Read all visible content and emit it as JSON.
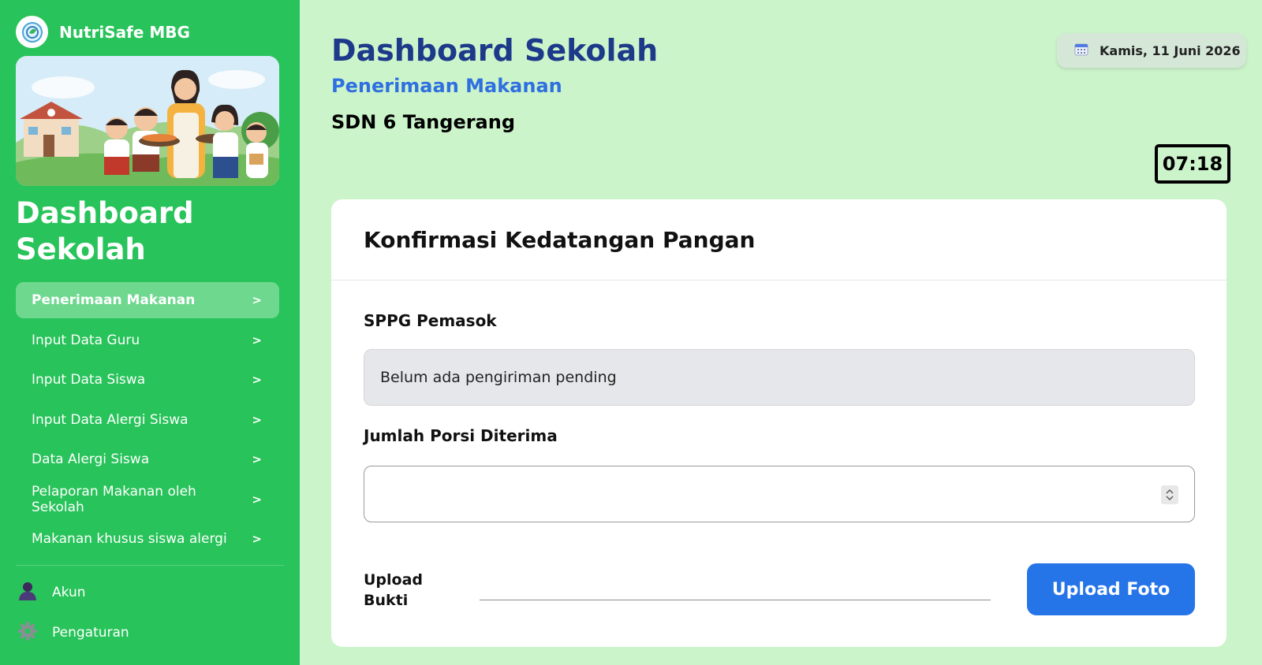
{
  "brand": {
    "name": "NutriSafe MBG",
    "logo_icon": "shield-leaf-icon"
  },
  "sidebar": {
    "title_line1": "Dashboard",
    "title_line2": "Sekolah",
    "items": [
      {
        "label": "Penerimaan Makanan",
        "arrow": ">",
        "active": true
      },
      {
        "label": "Input Data Guru",
        "arrow": ">"
      },
      {
        "label": "Input Data Siswa",
        "arrow": ">"
      },
      {
        "label": "Input Data Alergi Siswa",
        "arrow": ">"
      },
      {
        "label": "Data Alergi Siswa",
        "arrow": ">"
      },
      {
        "label": "Pelaporan Makanan oleh Sekolah",
        "arrow": ">"
      },
      {
        "label": "Makanan khusus siswa alergi",
        "arrow": ">"
      }
    ],
    "footer": [
      {
        "label": "Akun",
        "icon": "user-icon"
      },
      {
        "label": "Pengaturan",
        "icon": "gear-icon"
      }
    ]
  },
  "header": {
    "title": "Dashboard Sekolah",
    "subtitle": "Penerimaan Makanan",
    "school": "SDN 6 Tangerang",
    "date": "Kamis, 11 Juni 2026",
    "date_icon": "calendar-icon",
    "clock": "07:18"
  },
  "card": {
    "title": "Konfirmasi Kedatangan Pangan",
    "supplier_label": "SPPG Pemasok",
    "supplier_value": "Belum ada pengiriman pending",
    "portion_label": "Jumlah Porsi Diterima",
    "portion_value": "",
    "upload_label": "Upload Bukti",
    "upload_button": "Upload Foto"
  },
  "colors": {
    "sidebar": "#28c35a",
    "page_bg": "#ccf4cb",
    "title_blue": "#1d3a8a",
    "subtitle_blue": "#2f6fe0",
    "button_blue": "#2575e8"
  }
}
